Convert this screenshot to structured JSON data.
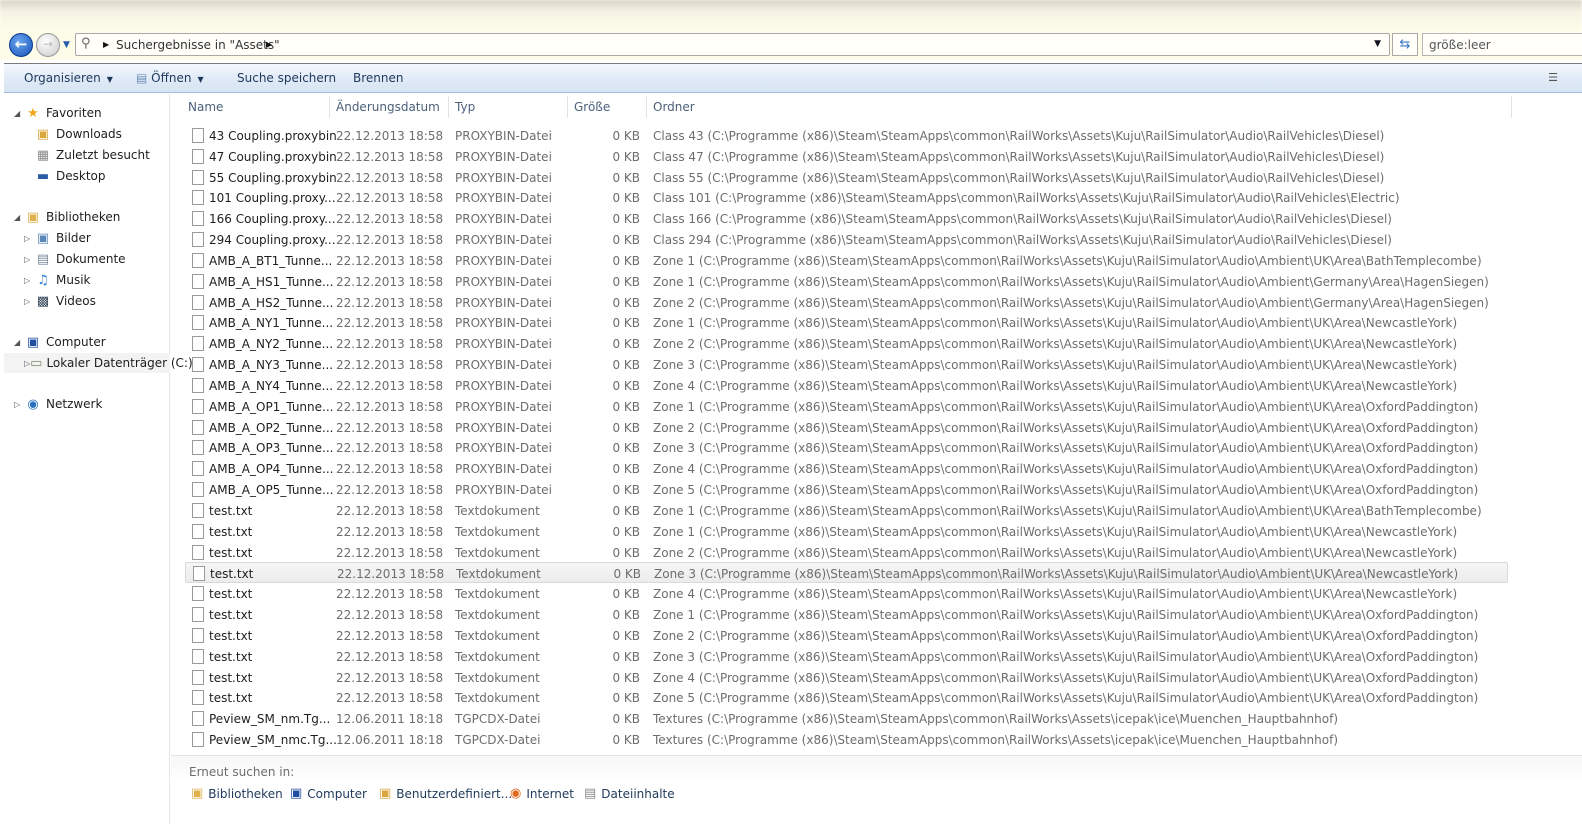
{
  "address": {
    "path": "Suchergebnisse in \"Assets\"",
    "search_value": "größe:leer"
  },
  "toolbar": {
    "organize": "Organisieren",
    "open": "Öffnen",
    "save_search": "Suche speichern",
    "burn": "Brennen"
  },
  "sidebar": {
    "favorites": "Favoriten",
    "downloads": "Downloads",
    "recent": "Zuletzt besucht",
    "desktop": "Desktop",
    "libraries": "Bibliotheken",
    "pictures": "Bilder",
    "documents": "Dokumente",
    "music": "Musik",
    "videos": "Videos",
    "computer": "Computer",
    "local_disk": "Lokaler Datenträger (C:)",
    "network": "Netzwerk"
  },
  "columns": {
    "name": "Name",
    "date": "Änderungsdatum",
    "type": "Typ",
    "size": "Größe",
    "folder": "Ordner"
  },
  "rows": [
    {
      "name": "43 Coupling.proxybin",
      "date": "22.12.2013 18:58",
      "type": "PROXYBIN-Datei",
      "size": "0 KB",
      "folder": "Class 43 (C:\\Programme (x86)\\Steam\\SteamApps\\common\\RailWorks\\Assets\\Kuju\\RailSimulator\\Audio\\RailVehicles\\Diesel)"
    },
    {
      "name": "47 Coupling.proxybin",
      "date": "22.12.2013 18:58",
      "type": "PROXYBIN-Datei",
      "size": "0 KB",
      "folder": "Class 47 (C:\\Programme (x86)\\Steam\\SteamApps\\common\\RailWorks\\Assets\\Kuju\\RailSimulator\\Audio\\RailVehicles\\Diesel)"
    },
    {
      "name": "55 Coupling.proxybin",
      "date": "22.12.2013 18:58",
      "type": "PROXYBIN-Datei",
      "size": "0 KB",
      "folder": "Class 55 (C:\\Programme (x86)\\Steam\\SteamApps\\common\\RailWorks\\Assets\\Kuju\\RailSimulator\\Audio\\RailVehicles\\Diesel)"
    },
    {
      "name": "101 Coupling.proxy...",
      "date": "22.12.2013 18:58",
      "type": "PROXYBIN-Datei",
      "size": "0 KB",
      "folder": "Class 101 (C:\\Programme (x86)\\Steam\\SteamApps\\common\\RailWorks\\Assets\\Kuju\\RailSimulator\\Audio\\RailVehicles\\Electric)"
    },
    {
      "name": "166 Coupling.proxy...",
      "date": "22.12.2013 18:58",
      "type": "PROXYBIN-Datei",
      "size": "0 KB",
      "folder": "Class 166 (C:\\Programme (x86)\\Steam\\SteamApps\\common\\RailWorks\\Assets\\Kuju\\RailSimulator\\Audio\\RailVehicles\\Diesel)"
    },
    {
      "name": "294 Coupling.proxy...",
      "date": "22.12.2013 18:58",
      "type": "PROXYBIN-Datei",
      "size": "0 KB",
      "folder": "Class 294 (C:\\Programme (x86)\\Steam\\SteamApps\\common\\RailWorks\\Assets\\Kuju\\RailSimulator\\Audio\\RailVehicles\\Diesel)"
    },
    {
      "name": "AMB_A_BT1_Tunne...",
      "date": "22.12.2013 18:58",
      "type": "PROXYBIN-Datei",
      "size": "0 KB",
      "folder": "Zone 1 (C:\\Programme (x86)\\Steam\\SteamApps\\common\\RailWorks\\Assets\\Kuju\\RailSimulator\\Audio\\Ambient\\UK\\Area\\BathTemplecombe)"
    },
    {
      "name": "AMB_A_HS1_Tunne...",
      "date": "22.12.2013 18:58",
      "type": "PROXYBIN-Datei",
      "size": "0 KB",
      "folder": "Zone 1 (C:\\Programme (x86)\\Steam\\SteamApps\\common\\RailWorks\\Assets\\Kuju\\RailSimulator\\Audio\\Ambient\\Germany\\Area\\HagenSiegen)"
    },
    {
      "name": "AMB_A_HS2_Tunne...",
      "date": "22.12.2013 18:58",
      "type": "PROXYBIN-Datei",
      "size": "0 KB",
      "folder": "Zone 2 (C:\\Programme (x86)\\Steam\\SteamApps\\common\\RailWorks\\Assets\\Kuju\\RailSimulator\\Audio\\Ambient\\Germany\\Area\\HagenSiegen)"
    },
    {
      "name": "AMB_A_NY1_Tunne...",
      "date": "22.12.2013 18:58",
      "type": "PROXYBIN-Datei",
      "size": "0 KB",
      "folder": "Zone 1 (C:\\Programme (x86)\\Steam\\SteamApps\\common\\RailWorks\\Assets\\Kuju\\RailSimulator\\Audio\\Ambient\\UK\\Area\\NewcastleYork)"
    },
    {
      "name": "AMB_A_NY2_Tunne...",
      "date": "22.12.2013 18:58",
      "type": "PROXYBIN-Datei",
      "size": "0 KB",
      "folder": "Zone 2 (C:\\Programme (x86)\\Steam\\SteamApps\\common\\RailWorks\\Assets\\Kuju\\RailSimulator\\Audio\\Ambient\\UK\\Area\\NewcastleYork)"
    },
    {
      "name": "AMB_A_NY3_Tunne...",
      "date": "22.12.2013 18:58",
      "type": "PROXYBIN-Datei",
      "size": "0 KB",
      "folder": "Zone 3 (C:\\Programme (x86)\\Steam\\SteamApps\\common\\RailWorks\\Assets\\Kuju\\RailSimulator\\Audio\\Ambient\\UK\\Area\\NewcastleYork)"
    },
    {
      "name": "AMB_A_NY4_Tunne...",
      "date": "22.12.2013 18:58",
      "type": "PROXYBIN-Datei",
      "size": "0 KB",
      "folder": "Zone 4 (C:\\Programme (x86)\\Steam\\SteamApps\\common\\RailWorks\\Assets\\Kuju\\RailSimulator\\Audio\\Ambient\\UK\\Area\\NewcastleYork)"
    },
    {
      "name": "AMB_A_OP1_Tunne...",
      "date": "22.12.2013 18:58",
      "type": "PROXYBIN-Datei",
      "size": "0 KB",
      "folder": "Zone 1 (C:\\Programme (x86)\\Steam\\SteamApps\\common\\RailWorks\\Assets\\Kuju\\RailSimulator\\Audio\\Ambient\\UK\\Area\\OxfordPaddington)"
    },
    {
      "name": "AMB_A_OP2_Tunne...",
      "date": "22.12.2013 18:58",
      "type": "PROXYBIN-Datei",
      "size": "0 KB",
      "folder": "Zone 2 (C:\\Programme (x86)\\Steam\\SteamApps\\common\\RailWorks\\Assets\\Kuju\\RailSimulator\\Audio\\Ambient\\UK\\Area\\OxfordPaddington)"
    },
    {
      "name": "AMB_A_OP3_Tunne...",
      "date": "22.12.2013 18:58",
      "type": "PROXYBIN-Datei",
      "size": "0 KB",
      "folder": "Zone 3 (C:\\Programme (x86)\\Steam\\SteamApps\\common\\RailWorks\\Assets\\Kuju\\RailSimulator\\Audio\\Ambient\\UK\\Area\\OxfordPaddington)"
    },
    {
      "name": "AMB_A_OP4_Tunne...",
      "date": "22.12.2013 18:58",
      "type": "PROXYBIN-Datei",
      "size": "0 KB",
      "folder": "Zone 4 (C:\\Programme (x86)\\Steam\\SteamApps\\common\\RailWorks\\Assets\\Kuju\\RailSimulator\\Audio\\Ambient\\UK\\Area\\OxfordPaddington)"
    },
    {
      "name": "AMB_A_OP5_Tunne...",
      "date": "22.12.2013 18:58",
      "type": "PROXYBIN-Datei",
      "size": "0 KB",
      "folder": "Zone 5 (C:\\Programme (x86)\\Steam\\SteamApps\\common\\RailWorks\\Assets\\Kuju\\RailSimulator\\Audio\\Ambient\\UK\\Area\\OxfordPaddington)"
    },
    {
      "name": "test.txt",
      "date": "22.12.2013 18:58",
      "type": "Textdokument",
      "size": "0 KB",
      "folder": "Zone 1 (C:\\Programme (x86)\\Steam\\SteamApps\\common\\RailWorks\\Assets\\Kuju\\RailSimulator\\Audio\\Ambient\\UK\\Area\\BathTemplecombe)"
    },
    {
      "name": "test.txt",
      "date": "22.12.2013 18:58",
      "type": "Textdokument",
      "size": "0 KB",
      "folder": "Zone 1 (C:\\Programme (x86)\\Steam\\SteamApps\\common\\RailWorks\\Assets\\Kuju\\RailSimulator\\Audio\\Ambient\\UK\\Area\\NewcastleYork)"
    },
    {
      "name": "test.txt",
      "date": "22.12.2013 18:58",
      "type": "Textdokument",
      "size": "0 KB",
      "folder": "Zone 2 (C:\\Programme (x86)\\Steam\\SteamApps\\common\\RailWorks\\Assets\\Kuju\\RailSimulator\\Audio\\Ambient\\UK\\Area\\NewcastleYork)"
    },
    {
      "name": "test.txt",
      "date": "22.12.2013 18:58",
      "type": "Textdokument",
      "size": "0 KB",
      "folder": "Zone 3 (C:\\Programme (x86)\\Steam\\SteamApps\\common\\RailWorks\\Assets\\Kuju\\RailSimulator\\Audio\\Ambient\\UK\\Area\\NewcastleYork)",
      "selected": true
    },
    {
      "name": "test.txt",
      "date": "22.12.2013 18:58",
      "type": "Textdokument",
      "size": "0 KB",
      "folder": "Zone 4 (C:\\Programme (x86)\\Steam\\SteamApps\\common\\RailWorks\\Assets\\Kuju\\RailSimulator\\Audio\\Ambient\\UK\\Area\\NewcastleYork)"
    },
    {
      "name": "test.txt",
      "date": "22.12.2013 18:58",
      "type": "Textdokument",
      "size": "0 KB",
      "folder": "Zone 1 (C:\\Programme (x86)\\Steam\\SteamApps\\common\\RailWorks\\Assets\\Kuju\\RailSimulator\\Audio\\Ambient\\UK\\Area\\OxfordPaddington)"
    },
    {
      "name": "test.txt",
      "date": "22.12.2013 18:58",
      "type": "Textdokument",
      "size": "0 KB",
      "folder": "Zone 2 (C:\\Programme (x86)\\Steam\\SteamApps\\common\\RailWorks\\Assets\\Kuju\\RailSimulator\\Audio\\Ambient\\UK\\Area\\OxfordPaddington)"
    },
    {
      "name": "test.txt",
      "date": "22.12.2013 18:58",
      "type": "Textdokument",
      "size": "0 KB",
      "folder": "Zone 3 (C:\\Programme (x86)\\Steam\\SteamApps\\common\\RailWorks\\Assets\\Kuju\\RailSimulator\\Audio\\Ambient\\UK\\Area\\OxfordPaddington)"
    },
    {
      "name": "test.txt",
      "date": "22.12.2013 18:58",
      "type": "Textdokument",
      "size": "0 KB",
      "folder": "Zone 4 (C:\\Programme (x86)\\Steam\\SteamApps\\common\\RailWorks\\Assets\\Kuju\\RailSimulator\\Audio\\Ambient\\UK\\Area\\OxfordPaddington)"
    },
    {
      "name": "test.txt",
      "date": "22.12.2013 18:58",
      "type": "Textdokument",
      "size": "0 KB",
      "folder": "Zone 5 (C:\\Programme (x86)\\Steam\\SteamApps\\common\\RailWorks\\Assets\\Kuju\\RailSimulator\\Audio\\Ambient\\UK\\Area\\OxfordPaddington)"
    },
    {
      "name": "Peview_SM_nm.Tg...",
      "date": "12.06.2011 18:18",
      "type": "TGPCDX-Datei",
      "size": "0 KB",
      "folder": "Textures (C:\\Programme (x86)\\Steam\\SteamApps\\common\\RailWorks\\Assets\\icepak\\ice\\Muenchen_Hauptbahnhof)"
    },
    {
      "name": "Peview_SM_nmc.Tg...",
      "date": "12.06.2011 18:18",
      "type": "TGPCDX-Datei",
      "size": "0 KB",
      "folder": "Textures (C:\\Programme (x86)\\Steam\\SteamApps\\common\\RailWorks\\Assets\\icepak\\ice\\Muenchen_Hauptbahnhof)"
    }
  ],
  "footer": {
    "label": "Erneut suchen in:",
    "libraries": "Bibliotheken",
    "computer": "Computer",
    "custom": "Benutzerdefiniert...",
    "internet": "Internet",
    "file_contents": "Dateiinhalte"
  }
}
